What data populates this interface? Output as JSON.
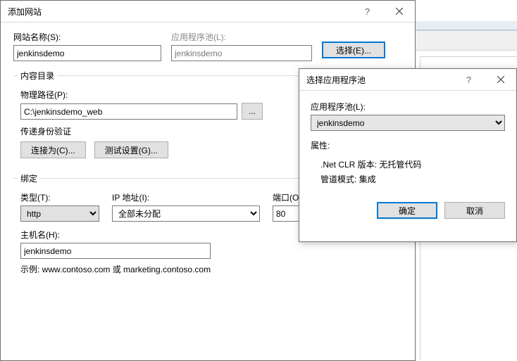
{
  "main": {
    "title": "添加网站",
    "site_name_label": "网站名称(S):",
    "site_name_value": "jenkinsdemo",
    "app_pool_label": "应用程序池(L):",
    "app_pool_value": "jenkinsdemo",
    "select_btn": "选择(E)...",
    "content_dir_legend": "内容目录",
    "phys_path_label": "物理路径(P):",
    "phys_path_value": "C:\\jenkinsdemo_web",
    "browse_btn": "...",
    "auth_label": "传递身份验证",
    "connect_as_btn": "连接为(C)...",
    "test_settings_btn": "测试设置(G)...",
    "binding_legend": "绑定",
    "type_label": "类型(T):",
    "type_value": "http",
    "ip_label": "IP 地址(I):",
    "ip_value": "全部未分配",
    "port_label": "端口(O):",
    "port_value": "80",
    "host_label": "主机名(H):",
    "host_value": "jenkinsdemo",
    "example_text": "示例: www.contoso.com 或 marketing.contoso.com"
  },
  "popup": {
    "title": "选择应用程序池",
    "pool_label": "应用程序池(L):",
    "pool_value": "jenkinsdemo",
    "attrs_label": "属性:",
    "clr_line": ".Net CLR 版本: 无托管代码",
    "pipeline_line": "管道模式: 集成",
    "ok_btn": "确定",
    "cancel_btn": "取消"
  }
}
